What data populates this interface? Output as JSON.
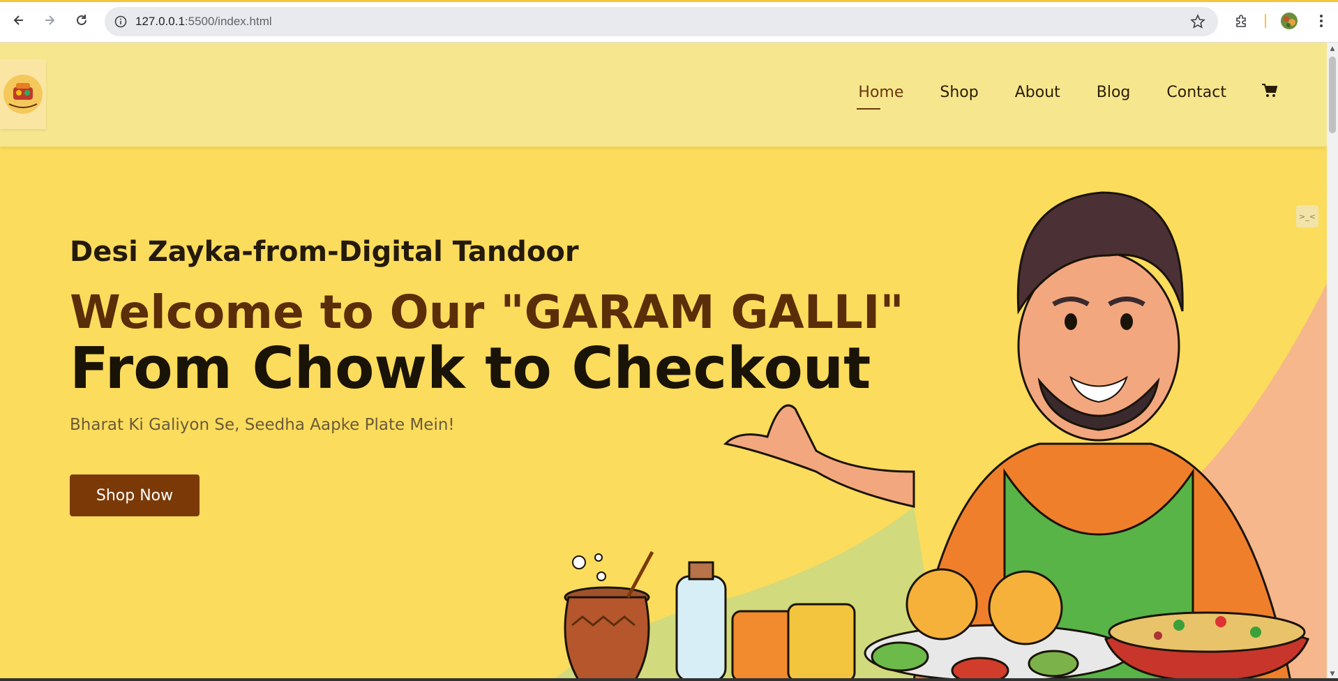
{
  "browser": {
    "url_host": "127.0.0.1",
    "url_path": ":5500/index.html",
    "back_icon": "arrow-left-icon",
    "forward_icon": "arrow-right-icon",
    "reload_icon": "reload-icon",
    "info_icon": "info-icon",
    "star_icon": "star-icon",
    "extensions_icon": "puzzle-icon",
    "menu_icon": "kebab-menu-icon"
  },
  "header": {
    "logo_alt": "GARAM GALLI",
    "nav": [
      {
        "label": "Home",
        "active": true
      },
      {
        "label": "Shop"
      },
      {
        "label": "About"
      },
      {
        "label": "Blog"
      },
      {
        "label": "Contact"
      }
    ],
    "cart_icon": "cart-icon"
  },
  "hero": {
    "subtitle": "Desi Zayka-from-Digital Tandoor",
    "welcome": "Welcome to Our \"GARAM GALLI\"",
    "headline": "From Chowk to Checkout",
    "tagline": "Bharat Ki Galiyon Se, Seedha Aapke Plate Mein!",
    "cta": "Shop Now"
  },
  "side_widget": {
    "label": ">_<"
  },
  "colors": {
    "header_bg": "#f6e78e",
    "hero_bg": "#fbdc5c",
    "accent_brown": "#7b3907",
    "welcome_text": "#5a2e08"
  }
}
